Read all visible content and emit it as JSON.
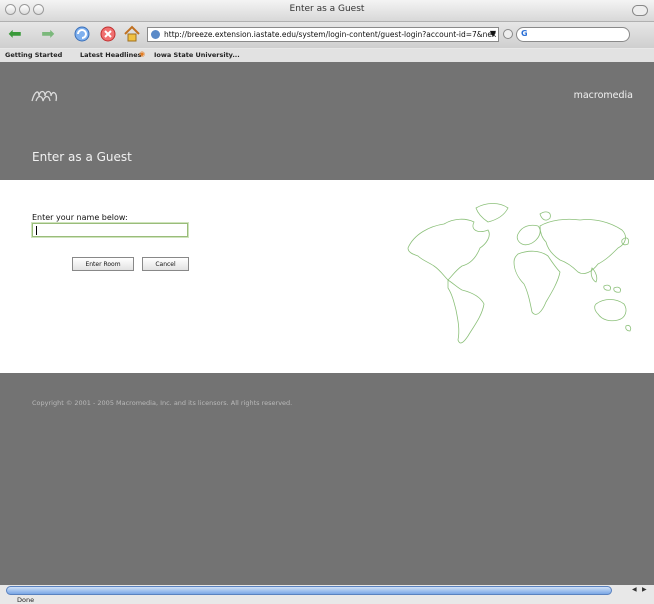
{
  "window": {
    "title": "Enter as a Guest"
  },
  "toolbar": {
    "icons": [
      "back-arrow-icon",
      "forward-arrow-icon",
      "reload-icon",
      "stop-icon",
      "home-icon"
    ],
    "url": "http://breeze.extension.iastate.edu/system/login-content/guest-login?account-id=7&nex",
    "search_engine": "G"
  },
  "bookmarks": [
    "Getting Started",
    "Latest Headlines",
    "Iowa State University..."
  ],
  "header": {
    "brand": "macromedia",
    "title": "Enter as a Guest"
  },
  "form": {
    "label": "Enter your name below:",
    "name_value": "",
    "enter_button": "Enter Room",
    "cancel_button": "Cancel"
  },
  "footer": {
    "copyright": "Copyright © 2001 - 2005 Macromedia, Inc. and its licensors. All rights reserved."
  },
  "status": {
    "text": "Done"
  },
  "colors": {
    "header_bg": "#737373",
    "accent_green": "#8cc07a",
    "scroll_blue": "#7aa7e5"
  }
}
